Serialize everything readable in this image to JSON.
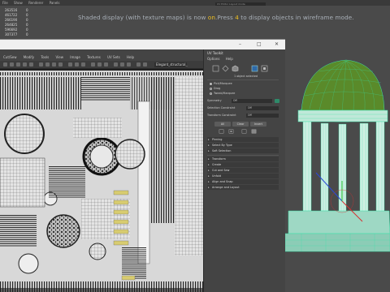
{
  "viewport": {
    "menubar": [
      "File",
      "Show",
      "Renderer",
      "Panels"
    ],
    "field_label": "UV Editor Layout mode",
    "hud_stats": [
      {
        "value": "263516",
        "col2": "0"
      },
      {
        "value": "461722",
        "col2": "0"
      },
      {
        "value": "266190",
        "col2": "0"
      },
      {
        "value": "264825",
        "col2": "0"
      },
      {
        "value": "596692",
        "col2": "0"
      },
      {
        "value": "307377",
        "col2": "0"
      }
    ],
    "message_prefix": "Shaded display (with texture maps) is now ",
    "message_on": "on",
    "message_mid": ".Press ",
    "message_key": "4",
    "message_suffix": " to display objects in wireframe mode."
  },
  "uv_editor": {
    "menu": [
      "Cut/Sew",
      "Modify",
      "Tools",
      "View",
      "Image",
      "Textures",
      "UV Sets",
      "Help"
    ],
    "uv_set_field": "Elegant_structural_"
  },
  "toolkit": {
    "title": "UV Toolkit",
    "menus": [
      "Options",
      "Help"
    ],
    "selected_status": "1 object selected",
    "pick_marquee": "Pick/Marquee",
    "drag": "Drag",
    "tweak_marquee": "Tweak/Marquee",
    "symmetry_label": "Symmetry",
    "symmetry_value": "Off",
    "selection_constraint_label": "Selection Constraint",
    "selection_constraint_value": "Off",
    "transform_constraint_label": "Transform Constraint",
    "transform_constraint_value": "Off",
    "btn_all": "All",
    "btn_clear": "Clear",
    "btn_invert": "Invert",
    "sections": [
      "Pinning",
      "Select By Type",
      "Soft Selection",
      "Transform",
      "Create",
      "Cut and Sew",
      "Unfold",
      "Align and Snap",
      "Arrange and Layout"
    ]
  },
  "colors": {
    "highlight": "#f0c020",
    "wire": "#39e0a8",
    "dome": "#5a8a2a",
    "panel": "#444444"
  }
}
